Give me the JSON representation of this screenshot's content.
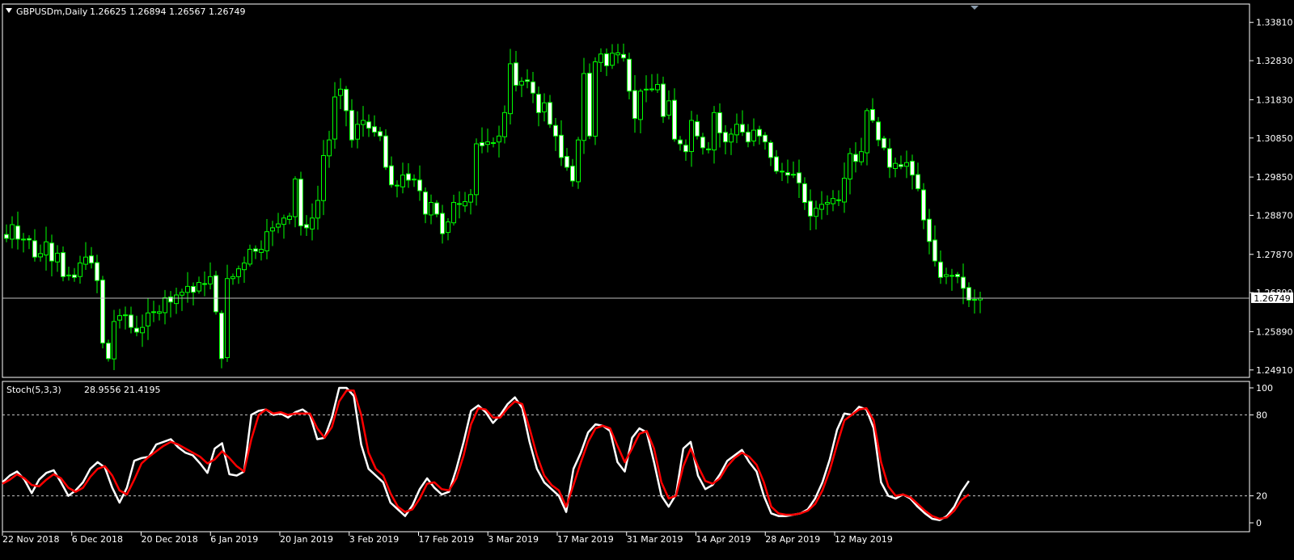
{
  "main_chart": {
    "header": "GBPUSDm,Daily",
    "ohlc": "1.26625 1.26894 1.26567 1.26749",
    "y_ticks": [
      1.3381,
      1.3283,
      1.3183,
      1.3085,
      1.2985,
      1.2887,
      1.2787,
      1.2689,
      1.2589,
      1.2491
    ],
    "y_tick_labels": [
      "1.33810",
      "1.32830",
      "1.31830",
      "1.30850",
      "1.29850",
      "1.28870",
      "1.27870",
      "1.26890",
      "1.25890",
      "1.24910"
    ],
    "ylim": [
      1.2472,
      1.3428
    ],
    "current_price": 1.26749,
    "current_price_label": "1.26749",
    "colors": {
      "up": "#00ff00",
      "down_body": "#ffffff",
      "price_line": "#c0c0c0",
      "axis": "#ffffff"
    }
  },
  "x_labels": [
    "22 Nov 2018",
    "6 Dec 2018",
    "20 Dec 2018",
    "6 Jan 2019",
    "20 Jan 2019",
    "3 Feb 2019",
    "17 Feb 2019",
    "3 Mar 2019",
    "17 Mar 2019",
    "31 Mar 2019",
    "14 Apr 2019",
    "28 Apr 2019",
    "12 May 2019"
  ],
  "chart_data": [
    {
      "type": "candlestick",
      "title": "GBPUSDm,Daily",
      "ylim": [
        1.2472,
        1.3428
      ],
      "close": [
        1.2828,
        1.2863,
        1.2826,
        1.2826,
        1.2824,
        1.278,
        1.2789,
        1.2819,
        1.277,
        1.279,
        1.273,
        1.2734,
        1.2728,
        1.2765,
        1.278,
        1.2765,
        1.272,
        1.256,
        1.252,
        1.2615,
        1.263,
        1.2632,
        1.26,
        1.2588,
        1.26,
        1.2637,
        1.264,
        1.264,
        1.2676,
        1.2665,
        1.2683,
        1.269,
        1.2705,
        1.269,
        1.2715,
        1.271,
        1.273,
        1.264,
        1.252,
        1.2725,
        1.273,
        1.275,
        1.2765,
        1.28,
        1.2795,
        1.28,
        1.2845,
        1.2855,
        1.2865,
        1.288,
        1.2885,
        1.298,
        1.286,
        1.2855,
        1.288,
        1.2925,
        1.304,
        1.308,
        1.319,
        1.321,
        1.3155,
        1.308,
        1.312,
        1.313,
        1.311,
        1.31,
        1.309,
        1.301,
        1.2965,
        1.2962,
        1.299,
        1.2977,
        1.2978,
        1.295,
        1.289,
        1.292,
        1.289,
        1.284,
        1.287,
        1.292,
        1.2915,
        1.2922,
        1.294,
        1.307,
        1.3065,
        1.3075,
        1.3073,
        1.309,
        1.315,
        1.3275,
        1.322,
        1.323,
        1.323,
        1.32,
        1.315,
        1.3175,
        1.312,
        1.309,
        1.3035,
        1.301,
        1.2975,
        1.308,
        1.325,
        1.309,
        1.328,
        1.33,
        1.327,
        1.3302,
        1.3303,
        1.329,
        1.3205,
        1.3135,
        1.3205,
        1.321,
        1.321,
        1.3222,
        1.314,
        1.318,
        1.3082,
        1.307,
        1.305,
        1.313,
        1.309,
        1.306,
        1.3055,
        1.315,
        1.3098,
        1.3075,
        1.3095,
        1.312,
        1.31,
        1.3075,
        1.3105,
        1.309,
        1.3075,
        1.3035,
        1.3,
        1.3,
        1.299,
        1.2992,
        1.297,
        1.292,
        1.2885,
        1.2905,
        1.2915,
        1.292,
        1.293,
        1.2925,
        1.2982,
        1.3045,
        1.3025,
        1.305,
        1.3155,
        1.313,
        1.308,
        1.306,
        1.301,
        1.302,
        1.3012,
        1.3022,
        1.299,
        1.2955,
        1.2875,
        1.282,
        1.277,
        1.2728,
        1.2735,
        1.2732,
        1.273,
        1.27,
        1.267,
        1.267,
        1.2675
      ]
    },
    {
      "type": "line",
      "title": "Stoch(5,3,3)",
      "readout": "28.9556 21.4195",
      "y_ticks": [
        100,
        80,
        20,
        0
      ],
      "y_tick_labels": [
        "100",
        "80",
        "20",
        "0"
      ],
      "levels": [
        80,
        20
      ],
      "ylim": [
        0,
        100
      ],
      "series": [
        {
          "color": "#ffffff",
          "values": [
            30,
            35,
            38,
            32,
            22,
            32,
            37,
            39,
            30,
            20,
            24,
            30,
            40,
            45,
            41,
            26,
            15,
            26,
            46,
            48,
            49,
            58,
            60,
            62,
            56,
            52,
            50,
            44,
            37,
            55,
            59,
            36,
            35,
            38,
            80,
            83,
            84,
            80,
            81,
            78,
            82,
            84,
            80,
            62,
            63,
            78,
            100,
            100,
            94,
            58,
            40,
            35,
            30,
            15,
            10,
            5,
            13,
            25,
            33,
            26,
            21,
            23,
            40,
            60,
            83,
            87,
            82,
            74,
            80,
            88,
            93,
            85,
            60,
            40,
            30,
            25,
            20,
            8,
            40,
            52,
            67,
            73,
            72,
            68,
            45,
            38,
            63,
            70,
            67,
            45,
            20,
            12,
            21,
            55,
            60,
            35,
            25,
            28,
            36,
            46,
            50,
            54,
            45,
            38,
            20,
            7,
            5,
            5,
            6,
            7,
            10,
            18,
            30,
            47,
            69,
            81,
            80,
            86,
            84,
            70,
            30,
            20,
            18,
            21,
            18,
            12,
            7,
            3,
            2,
            5,
            12,
            23,
            31
          ]
        },
        {
          "color": "#ff0000",
          "values": [
            29,
            32,
            36,
            33,
            28,
            27,
            32,
            36,
            33,
            26,
            23,
            26,
            34,
            40,
            42,
            35,
            24,
            21,
            32,
            44,
            49,
            53,
            57,
            60,
            58,
            55,
            52,
            49,
            44,
            47,
            53,
            48,
            42,
            38,
            62,
            80,
            84,
            81,
            82,
            80,
            81,
            81,
            81,
            70,
            63,
            71,
            90,
            98,
            98,
            80,
            52,
            40,
            35,
            22,
            12,
            8,
            10,
            18,
            29,
            30,
            25,
            24,
            33,
            50,
            73,
            85,
            84,
            78,
            78,
            85,
            90,
            88,
            70,
            50,
            35,
            28,
            24,
            12,
            28,
            45,
            60,
            70,
            72,
            70,
            57,
            45,
            55,
            66,
            68,
            55,
            30,
            18,
            20,
            42,
            55,
            42,
            31,
            29,
            33,
            42,
            48,
            52,
            49,
            43,
            30,
            12,
            7,
            6,
            6,
            7,
            9,
            14,
            24,
            39,
            58,
            76,
            80,
            84,
            85,
            76,
            45,
            27,
            20,
            21,
            19,
            14,
            9,
            5,
            3,
            4,
            9,
            17,
            21
          ]
        }
      ]
    }
  ]
}
